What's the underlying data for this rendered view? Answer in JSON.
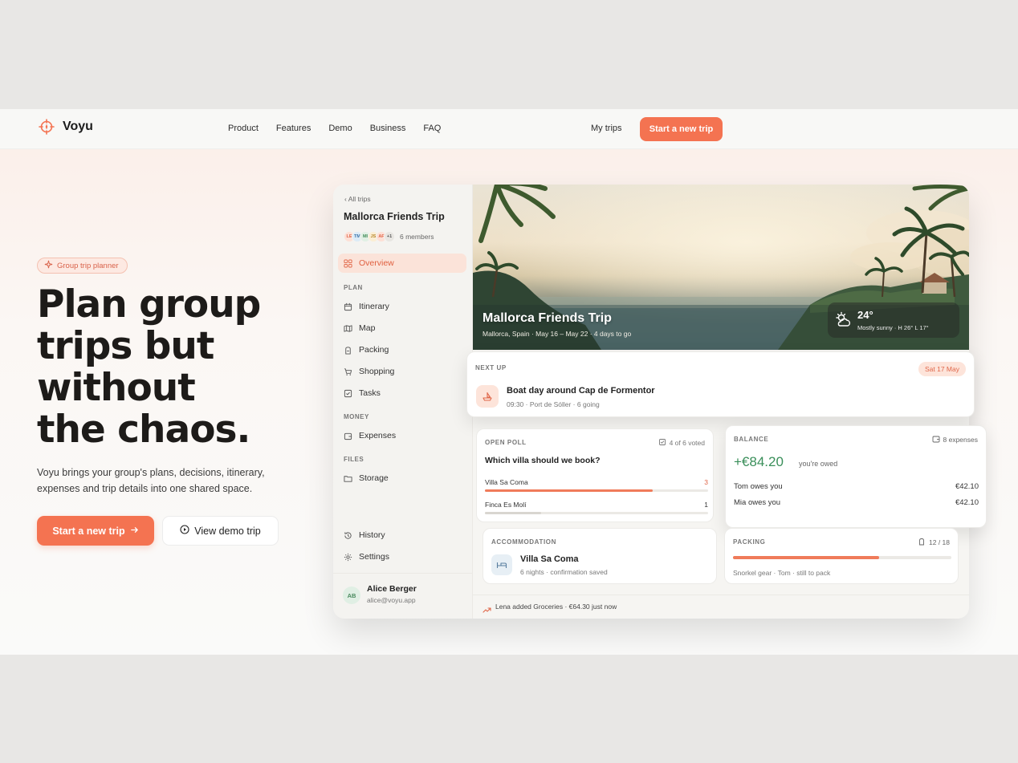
{
  "nav": {
    "brand": "Voyu",
    "links": [
      "Product",
      "Features",
      "Demo",
      "Business",
      "FAQ"
    ],
    "my_trips": "My trips",
    "cta": "Start a new trip"
  },
  "hero": {
    "badge": "Group trip planner",
    "headline": [
      "Plan group",
      "trips but",
      "without",
      "the chaos."
    ],
    "subtext": "Voyu brings your group's plans, decisions, itinerary, expenses and trip details into one shared space.",
    "primary_button": "Start a new trip",
    "secondary_button": "View demo trip"
  },
  "app": {
    "sidebar": {
      "back": "All trips",
      "trip_title": "Mallorca Friends Trip",
      "avatars": [
        "LE",
        "TM",
        "MI",
        "JS",
        "AF",
        "+1"
      ],
      "members": "6 members",
      "overview": "Overview",
      "section_plan": "PLAN",
      "plan_items": [
        "Itinerary",
        "Map",
        "Packing",
        "Shopping",
        "Tasks"
      ],
      "section_money": "MONEY",
      "money_items": [
        "Expenses"
      ],
      "section_files": "FILES",
      "files_items": [
        "Storage"
      ],
      "history": "History",
      "settings": "Settings",
      "user": {
        "initials": "AB",
        "name": "Alice Berger",
        "email": "alice@voyu.app"
      }
    },
    "photo": {
      "title": "Mallorca Friends Trip",
      "subtitle": "Mallorca, Spain · May 16 – May 22 · 4 days to go",
      "weather_temp": "24°",
      "weather_desc": "Mostly sunny · H 26° L 17°"
    },
    "next_up": {
      "label": "NEXT UP",
      "date": "Sat 17 May",
      "title": "Boat day around Cap de Formentor",
      "meta": "09:30 · Port de Sóller · 6 going"
    },
    "poll": {
      "label": "OPEN POLL",
      "votes": "4 of 6 voted",
      "question": "Which villa should we book?",
      "options": [
        {
          "name": "Villa Sa Coma",
          "votes": "3",
          "fraction": 0.75
        },
        {
          "name": "Finca Es Molí",
          "votes": "1",
          "fraction": 0.25
        }
      ]
    },
    "balance": {
      "label": "BALANCE",
      "expenses": "8 expenses",
      "amount": "+€84.20",
      "owed": "you're owed",
      "rows": [
        {
          "who": "Tom owes you",
          "amount": "€42.10"
        },
        {
          "who": "Mia owes you",
          "amount": "€42.10"
        }
      ]
    },
    "accommodation": {
      "label": "ACCOMMODATION",
      "name": "Villa Sa Coma",
      "meta": "6 nights · confirmation saved"
    },
    "packing": {
      "label": "PACKING",
      "count": "12 / 18",
      "progress": 0.67,
      "meta": "Snorkel gear · Tom · still to pack"
    },
    "activity": "Lena added Groceries · €64.30 just now"
  },
  "colors": {
    "accent": "#f47351",
    "positive": "#3a8f5a"
  }
}
